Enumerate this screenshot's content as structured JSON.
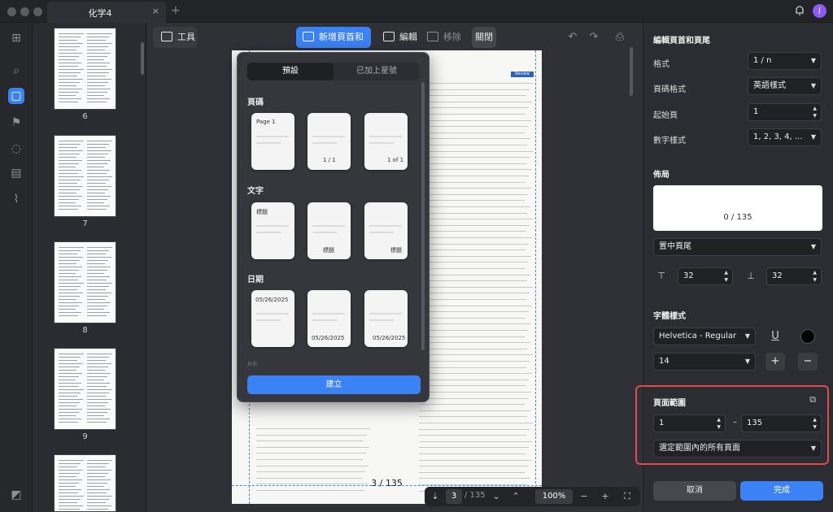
{
  "window": {
    "tab_title": "化学4",
    "tab_close": "×",
    "tab_add": "+",
    "avatar_initial": "J"
  },
  "rail": {
    "icons": [
      "grid-icon",
      "search-icon",
      "page-icon",
      "bookmark-icon",
      "comment-icon",
      "form-icon",
      "attachment-icon",
      "layers-icon"
    ]
  },
  "thumbnails": [
    {
      "label": "6"
    },
    {
      "label": "7"
    },
    {
      "label": "8"
    },
    {
      "label": "9"
    }
  ],
  "toolbar": {
    "tools_label": "工具",
    "add_header_footer_label": "新增頁首和頁尾",
    "edit_label": "編輯",
    "remove_label": "移除",
    "close_label": "關閉",
    "undo": "↶",
    "redo": "↷",
    "save": "⎙"
  },
  "document": {
    "review_tag": "Review",
    "page_indicator": "3 / 135"
  },
  "popup": {
    "tab_presets": "預設",
    "tab_starred": "已加上星號",
    "section_page_number": "頁碼",
    "section_text": "文字",
    "section_date": "日期",
    "templates_page_number": [
      {
        "text": "Page 1"
      },
      {
        "text": "1 / 1"
      },
      {
        "text": "1 of 1"
      }
    ],
    "templates_text": [
      {
        "text": "標題"
      },
      {
        "text": "標題"
      },
      {
        "text": "標題"
      }
    ],
    "templates_date": [
      {
        "text": "05/26/2025"
      },
      {
        "text": "05/26/2025"
      },
      {
        "text": "05/26/2025"
      }
    ],
    "section_more": "其他",
    "create_label": "建立"
  },
  "bottom_nav": {
    "current_page": "3",
    "total_pages": "/ 135",
    "zoom": "100%",
    "zoom_out": "−",
    "zoom_in": "+"
  },
  "panel": {
    "title": "編輯頁首和頁尾",
    "format_label": "格式",
    "format_value": "1 / n",
    "page_format_label": "頁碼格式",
    "page_format_value": "英語樣式",
    "start_page_label": "起始頁",
    "start_page_value": "1",
    "number_style_label": "數字樣式",
    "number_style_value": "1, 2, 3, 4, ...",
    "layout_title": "佈局",
    "preview_text": "0 / 135",
    "position_value": "置中頁尾",
    "margin_top_value": "32",
    "margin_bottom_value": "32",
    "font_title": "字體樣式",
    "font_value": "Helvetica - Regular",
    "font_size_value": "14",
    "underline_glyph": "U",
    "plus": "+",
    "minus": "−",
    "page_range_title": "頁面範圍",
    "range_from": "1",
    "range_dash": "–",
    "range_to": "135",
    "range_mode_value": "選定範圍內的所有頁面",
    "cancel_label": "取消",
    "done_label": "完成",
    "font_color": "#000000",
    "accent_color": "#3b82f6"
  }
}
